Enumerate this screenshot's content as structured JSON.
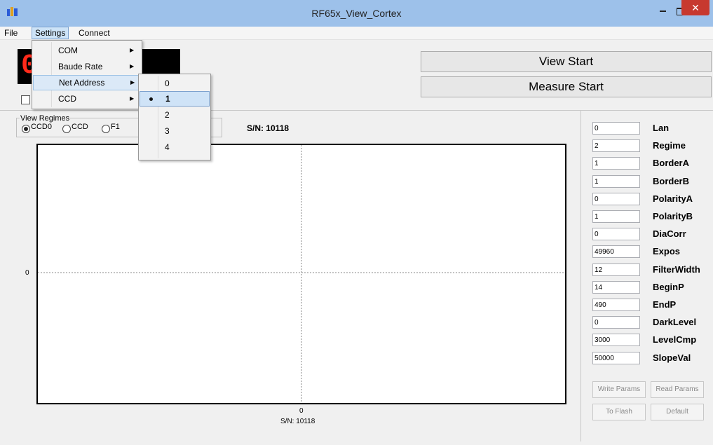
{
  "window": {
    "title": "RF65x_View_Cortex"
  },
  "menu": {
    "file": "File",
    "settings": "Settings",
    "connect": "Connect"
  },
  "settings_menu": {
    "items": [
      {
        "label": "COM"
      },
      {
        "label": "Baude Rate"
      },
      {
        "label": "Net Address"
      },
      {
        "label": "CCD"
      }
    ],
    "net_address": {
      "options": [
        "0",
        "1",
        "2",
        "3",
        "4"
      ],
      "selected": "1"
    }
  },
  "display": {
    "value": "0"
  },
  "buttons": {
    "view_start": "View Start",
    "measure_start": "Measure Start"
  },
  "regimes": {
    "title": "View Regimes",
    "options": [
      "CCD0",
      "CCD",
      "F1"
    ],
    "selected": "CCD0"
  },
  "serial": {
    "top": "S/N: 10118",
    "bottom": "S/N: 10118"
  },
  "plot": {
    "y_zero": "0",
    "x_zero": "0"
  },
  "params": [
    {
      "value": "0",
      "label": "Lan"
    },
    {
      "value": "2",
      "label": "Regime"
    },
    {
      "value": "1",
      "label": "BorderA"
    },
    {
      "value": "1",
      "label": "BorderB"
    },
    {
      "value": "0",
      "label": "PolarityA"
    },
    {
      "value": "1",
      "label": "PolarityB"
    },
    {
      "value": "0",
      "label": "DiaCorr"
    },
    {
      "value": "49960",
      "label": "Expos"
    },
    {
      "value": "12",
      "label": "FilterWidth"
    },
    {
      "value": "14",
      "label": "BeginP"
    },
    {
      "value": "490",
      "label": "EndP"
    },
    {
      "value": "0",
      "label": "DarkLevel"
    },
    {
      "value": "3000",
      "label": "LevelCmp"
    },
    {
      "value": "50000",
      "label": "SlopeVal"
    }
  ],
  "param_buttons": {
    "write": "Write Params",
    "read": "Read Params",
    "flash": "To Flash",
    "default": "Default"
  },
  "colors": {
    "titlebar": "#9dc1ea",
    "close": "#c7392f",
    "led_digit": "#ff2a1a",
    "menu_highlight": "#cde3f7"
  }
}
